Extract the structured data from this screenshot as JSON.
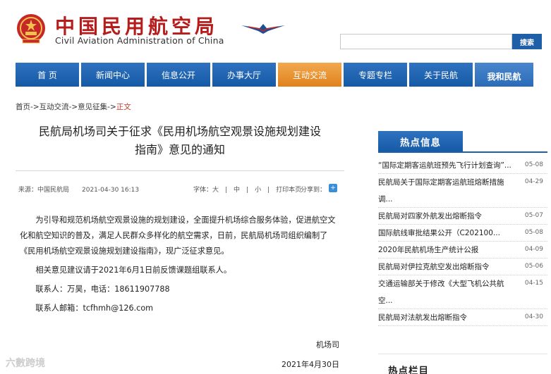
{
  "header": {
    "title_cn": "中国民用航空局",
    "title_en": "Civil Aviation Administration of China",
    "search_placeholder": "",
    "search_button": "搜索"
  },
  "nav": [
    {
      "label": "首 页"
    },
    {
      "label": "新闻中心"
    },
    {
      "label": "信息公开"
    },
    {
      "label": "办事大厅"
    },
    {
      "label": "互动交流"
    },
    {
      "label": "专题专栏"
    },
    {
      "label": "关于民航"
    },
    {
      "label": "我和民航"
    }
  ],
  "breadcrumb": {
    "path": "首页->互动交流->意见征集->",
    "current": "正文"
  },
  "article": {
    "title_line1": "民航局机场司关于征求《民用机场航空观景设施规划建设",
    "title_line2": "指南》意见的通知",
    "meta_source": "来源：中国民航局　　2021-04-30 16:13",
    "meta_fontsize": "字体：大　|　中　|　小　|　打印本页",
    "meta_share": "分享到：",
    "para1": "为引导和规范机场航空观景设施的规划建设，全面提升机场综合服务体验，促进航空文化和航空知识的普及，满足人民群众多样化的航空需求，日前，民航局机场司组织编制了《民用机场航空观景设施规划建设指南》，现广泛征求意见。",
    "para2": "相关意见建议请于2021年6月1日前反馈课题组联系人。",
    "contact": "联系人：万昊，电话：18611907788",
    "email": "联系人邮箱：tcfhmh@126.com",
    "signature": "机场司",
    "date": "2021年4月30日"
  },
  "sidebar": {
    "hot_title": "热点信息",
    "hot_items": [
      {
        "title": "“国际定期客运航班预先飞行计划查询”...",
        "date": "05-08"
      },
      {
        "title": "民航局关于国际定期客运航班熔断措施调...",
        "date": "04-29"
      },
      {
        "title": "民航局对四家外航发出熔断指令",
        "date": "05-07"
      },
      {
        "title": "国际航线审批结果公开（C202100...",
        "date": "05-08"
      },
      {
        "title": "2020年民航机场生产统计公报",
        "date": "04-09"
      },
      {
        "title": "民航局对伊拉克航空发出熔断指令",
        "date": "05-06"
      },
      {
        "title": "交通运输部关于修改《大型飞机公共航空...",
        "date": "04-15"
      },
      {
        "title": "民航局对法航发出熔断指令",
        "date": "04-30"
      }
    ],
    "columns_title": "热点栏目"
  },
  "watermark": "六數跨境",
  "colors": {
    "nav_blue": "#1f5fa8",
    "nav_active": "#e8922f",
    "brand_red": "#b71c1c",
    "breadcrumb_current": "#c0392b"
  }
}
